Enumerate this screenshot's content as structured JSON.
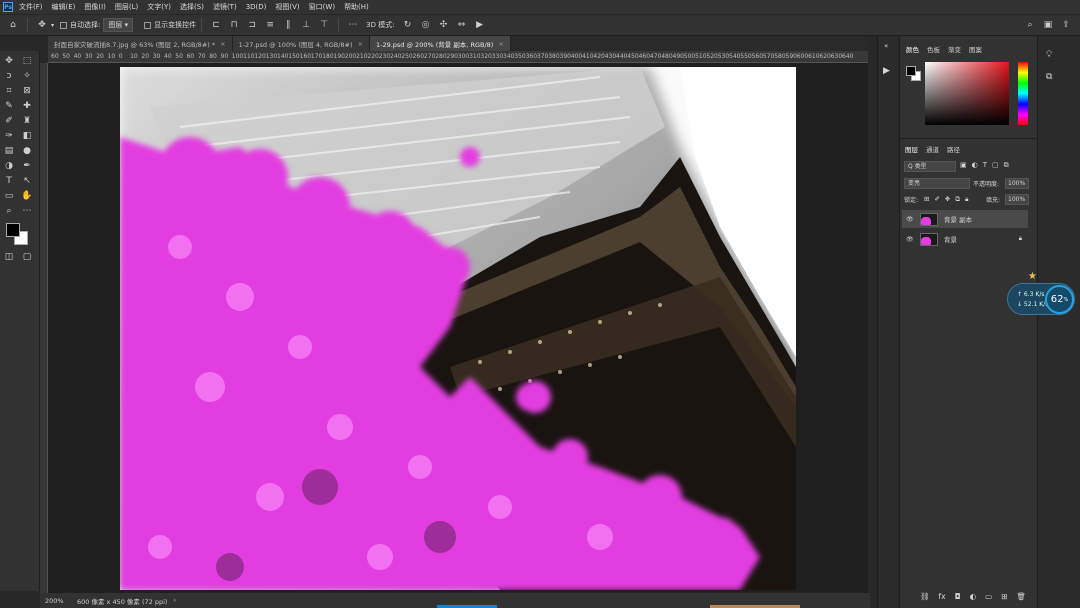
{
  "menubar": {
    "items": [
      "文件(F)",
      "编辑(E)",
      "图像(I)",
      "图层(L)",
      "文字(Y)",
      "选择(S)",
      "滤镜(T)",
      "3D(D)",
      "视图(V)",
      "窗口(W)",
      "帮助(H)"
    ]
  },
  "options": {
    "auto_select": "自动选择:",
    "layer_mode": "图层",
    "show_transform": "显示变换控件",
    "mode_3d": "3D 模式:"
  },
  "tabs": [
    {
      "label": "封面自家灾破流插8.7.jpg @ 63% (图层 2, RGB/8#) *",
      "close": "×"
    },
    {
      "label": "1-27.psd @ 100% (图层 4, RGB/8#)",
      "close": "×"
    },
    {
      "label": "1-29.psd @ 200% (背景 副本, RGB/8)",
      "close": "×"
    }
  ],
  "ruler_labels": [
    "60",
    "50",
    "40",
    "30",
    "20",
    "10",
    "0",
    "10",
    "20",
    "30",
    "40",
    "50",
    "60",
    "70",
    "80",
    "90",
    "100",
    "110",
    "120",
    "130",
    "140",
    "150",
    "160",
    "170",
    "180",
    "190",
    "200",
    "210",
    "220",
    "230",
    "240",
    "250",
    "260",
    "270",
    "280",
    "290",
    "300",
    "310",
    "320",
    "330",
    "340",
    "350",
    "360",
    "370",
    "380",
    "390",
    "400",
    "410",
    "420",
    "430",
    "440",
    "450",
    "460",
    "470",
    "480",
    "490",
    "500",
    "510",
    "520",
    "530",
    "540",
    "550",
    "560",
    "570",
    "580",
    "590",
    "600",
    "610",
    "620",
    "630",
    "640"
  ],
  "status": {
    "zoom": "200%",
    "doc_info": "600 像素 x 450 像素 (72 ppi)"
  },
  "color_panel": {
    "tabs": [
      "颜色",
      "色板",
      "渐变",
      "图案"
    ]
  },
  "layers_panel": {
    "tabs": [
      "图层",
      "通道",
      "路径"
    ],
    "filter": "Q 类型",
    "blend_mode": "变亮",
    "opacity_label": "不透明度:",
    "opacity_value": "100%",
    "lock_label": "锁定:",
    "fill_label": "填充:",
    "fill_value": "100%",
    "layers": [
      {
        "name": "背景 副本",
        "selected": true
      },
      {
        "name": "背景",
        "locked": true
      }
    ]
  },
  "net_widget": {
    "up": "↑ 6.3 K/s",
    "down": "↓ 52.1 K/s",
    "cpu": "62",
    "unit": "%"
  },
  "colors": {
    "flower": "#e23ee0",
    "ui_bg": "#323232",
    "accent": "#0b87d8"
  }
}
